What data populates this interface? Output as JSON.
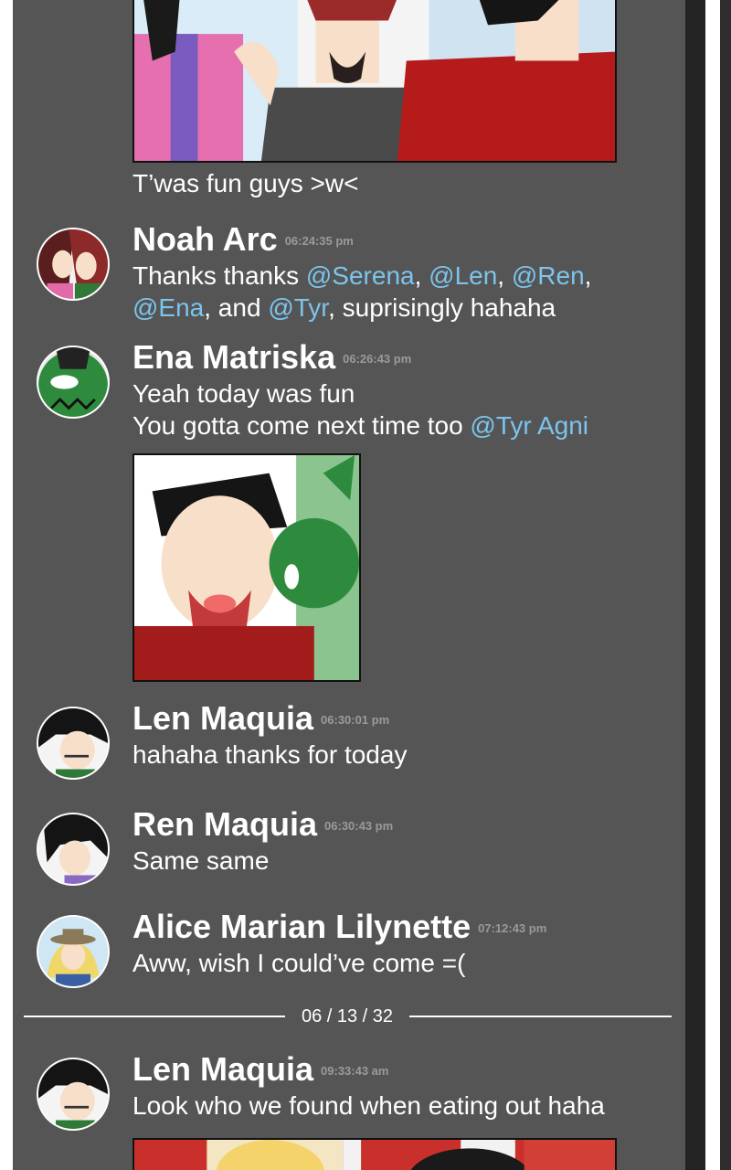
{
  "messages": [
    {
      "id": "m0",
      "text": "T’was fun guys >w<"
    },
    {
      "id": "m1",
      "author": "Noah Arc",
      "time": "06:24:35 pm",
      "line1": {
        "a": "Thanks thanks ",
        "m1": "@Serena",
        "b": ", ",
        "m2": "@Len",
        "c": ", ",
        "m3": "@Ren",
        "d": ","
      },
      "line2": {
        "m1": "@Ena",
        "a": ", and ",
        "m2": "@Tyr",
        "b": ", suprisingly hahaha"
      }
    },
    {
      "id": "m2",
      "author": "Ena Matriska",
      "time": "06:26:43 pm",
      "line1": "Yeah today was fun",
      "line2": {
        "a": "You gotta come next time too ",
        "m1": "@Tyr Agni"
      }
    },
    {
      "id": "m3",
      "author": "Len Maquia",
      "time": "06:30:01 pm",
      "text": "hahaha thanks for today"
    },
    {
      "id": "m4",
      "author": "Ren Maquia",
      "time": "06:30:43 pm",
      "text": "Same same"
    },
    {
      "id": "m5",
      "author": "Alice Marian Lilynette",
      "time": "07:12:43 pm",
      "text": "Aww, wish I could’ve come =("
    },
    {
      "id": "m6",
      "author": "Len Maquia",
      "time": "09:33:43 am",
      "text": "Look who we found when eating out haha"
    }
  ],
  "date_divider": "06 / 13 / 32",
  "colors": {
    "panel": "#555555",
    "mention": "#7cc4ee",
    "timestamp": "#9a9a9a",
    "rail": "#232323"
  }
}
